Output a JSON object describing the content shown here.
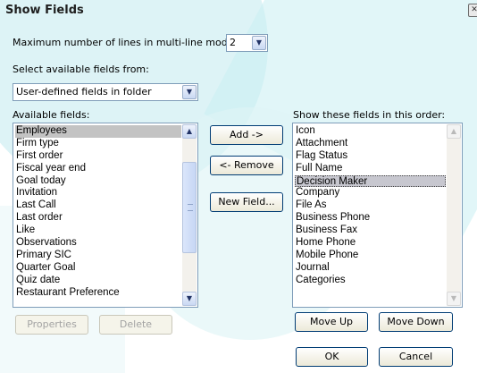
{
  "dialog": {
    "title": "Show Fields"
  },
  "max_lines": {
    "label": "Maximum number of lines in multi-line mode:",
    "value": "2"
  },
  "select_from": {
    "label": "Select available fields from:",
    "value": "User-defined fields in folder"
  },
  "available": {
    "label": "Available fields:",
    "items": [
      "Employees",
      "Firm type",
      "First order",
      "Fiscal year end",
      "Goal today",
      "Invitation",
      "Last Call",
      "Last order",
      "Like",
      "Observations",
      "Primary SIC",
      "Quarter Goal",
      "Quiz date",
      "Restaurant Preference"
    ],
    "selected_index": 0
  },
  "shown": {
    "label": "Show these fields in this order:",
    "items": [
      "Icon",
      "Attachment",
      "Flag Status",
      "Full Name",
      "Decision Maker",
      "Company",
      "File As",
      "Business Phone",
      "Business Fax",
      "Home Phone",
      "Mobile Phone",
      "Journal",
      "Categories"
    ],
    "selected_index": 4
  },
  "buttons": {
    "add": "Add ->",
    "remove": "<- Remove",
    "new_field": "New Field...",
    "properties": "Properties",
    "delete": "Delete",
    "move_up": "Move Up",
    "move_down": "Move Down",
    "ok": "OK",
    "cancel": "Cancel"
  },
  "icons": {
    "close": "close-icon",
    "dropdown": "chevron-down-icon",
    "scroll_up": "chevron-up-icon",
    "scroll_down": "chevron-down-icon"
  }
}
